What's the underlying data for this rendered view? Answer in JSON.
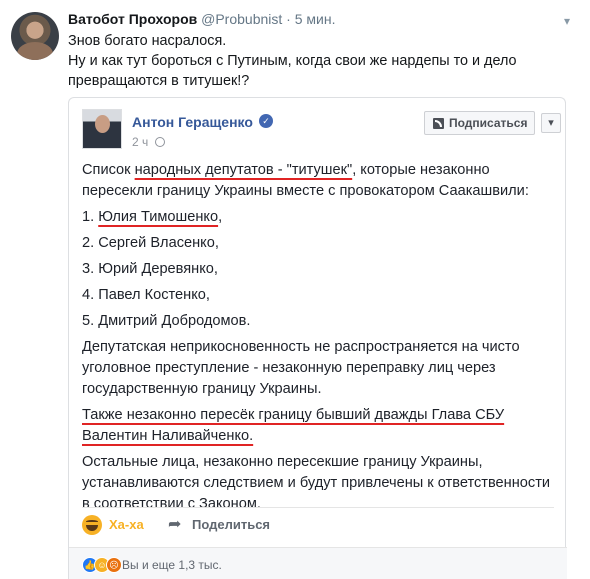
{
  "tweet": {
    "author_name": "Ватобот Прохоров",
    "author_handle": "@Probubnist",
    "separator": "·",
    "time": "5 мин.",
    "lines": [
      "Знов богато насралося.",
      "Ну и как тут бороться с Путиным, когда свои же нардепы то и дело превращаются в титушек!?"
    ]
  },
  "post": {
    "author_name": "Антон Геращенко",
    "time": "2 ч",
    "follow_label": "Подписаться",
    "intro_before": "Список ",
    "intro_highlight": "народных депутатов - \"титушек\"",
    "intro_after": ", которые незаконно пересекли границу Украины вместе с провокатором Саакашвили:",
    "item1_number": "1. ",
    "item1_name": "Юлия Тимошенко",
    "item1_tail": ",",
    "list": [
      "2. Сергей Власенко,",
      "3. Юрий Деревянко,",
      "4. Павел Костенко,",
      "5. Дмитрий Добродомов."
    ],
    "paragraph_immunity": "Депутатская неприкосновенность не распространяется на чисто уголовное преступление - незаконную переправку лиц через государственную границу Украины.",
    "paragraph_sbu": "Также незаконно пересёк границу бывший дважды Глава СБУ Валентин Наливайченко.",
    "paragraph_others": "Остальные лица, незаконно пересекшие границу Украины, устанавливаются следствием и будут привлечены к ответственности в соответствии с Законом."
  },
  "actions": {
    "reaction_label": "Ха-ха",
    "share_label": "Поделиться"
  },
  "footer": {
    "reactions_text": "Вы и еще 1,3 тыс."
  },
  "icons": [
    "avatar",
    "chevron-down-icon",
    "verified-icon",
    "globe-icon",
    "rss-icon",
    "more-icon",
    "haha-icon",
    "share-icon",
    "like-icon",
    "angry-icon"
  ],
  "colors": {
    "link_blue": "#365899",
    "facebook_blue": "#4267b2",
    "highlight_red": "#e02424",
    "haha_yellow": "#f7b125"
  }
}
